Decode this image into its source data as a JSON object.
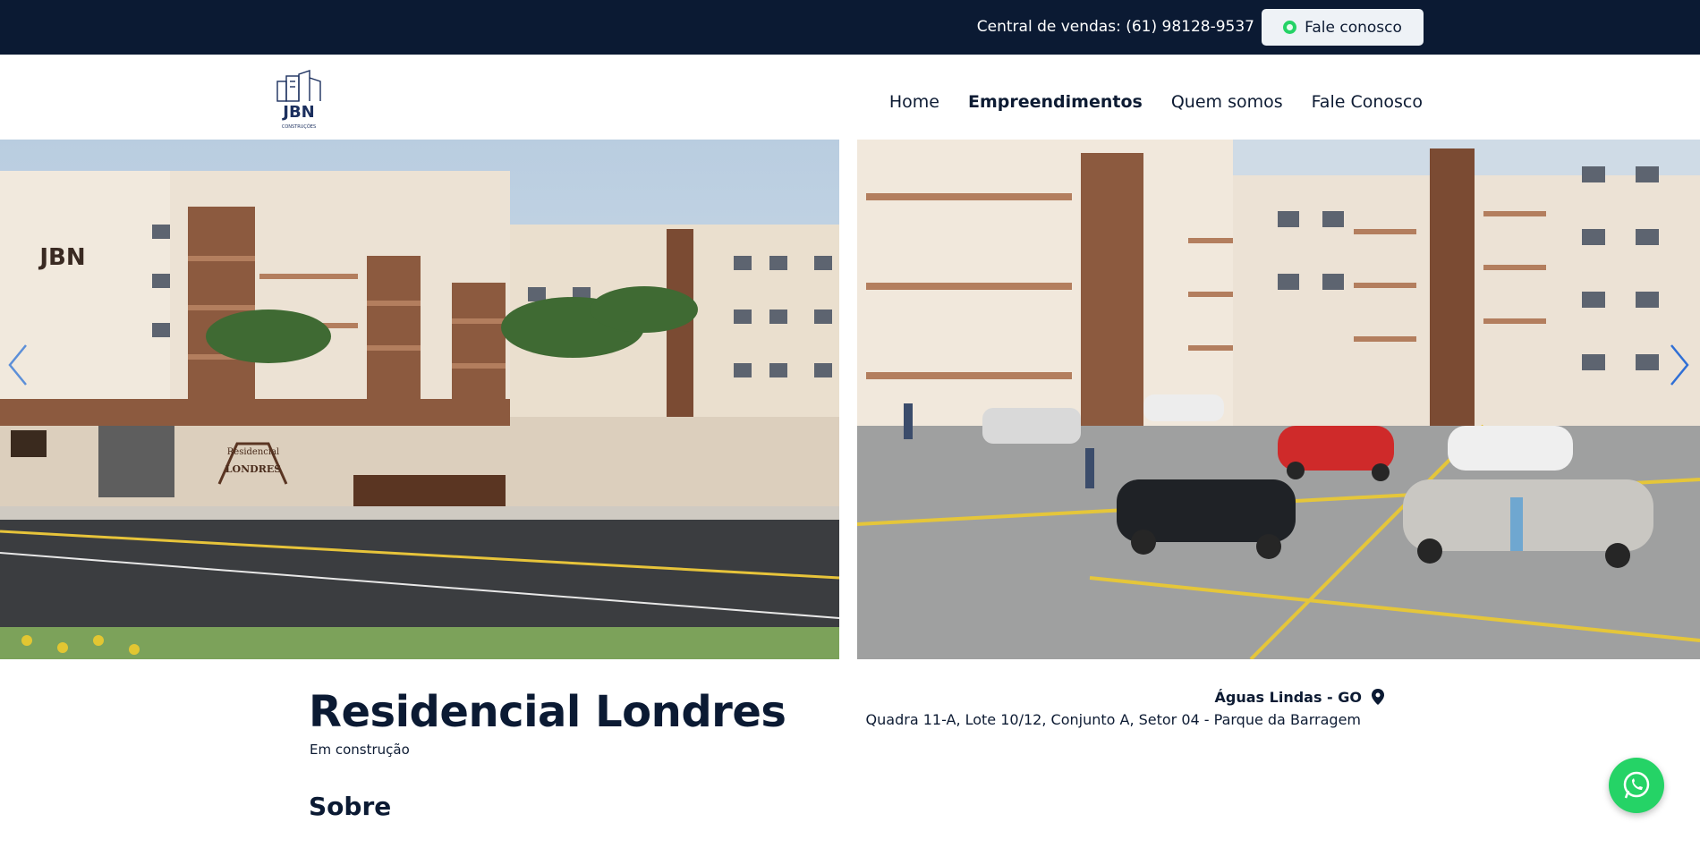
{
  "topbar": {
    "sales_text": "Central de vendas: (61) 98128-9537",
    "cta_label": "Fale conosco"
  },
  "header": {
    "logo_text": "JBN",
    "logo_subtext": "CONSTRUÇÕES",
    "nav": [
      {
        "label": "Home"
      },
      {
        "label": "Empreendimentos"
      },
      {
        "label": "Quem somos"
      },
      {
        "label": "Fale Conosco"
      }
    ]
  },
  "gallery": {
    "slide_1_sign": "Residencial\nLONDRES"
  },
  "property": {
    "title": "Residencial Londres",
    "status": "Em construção",
    "city": "Águas Lindas - GO",
    "address": "Quadra 11-A, Lote 10/12, Conjunto A, Setor 04 - Parque da Barragem"
  },
  "section": {
    "about_heading": "Sobre"
  },
  "colors": {
    "navy": "#0b1a33",
    "whatsapp": "#25d366",
    "arrow": "#3b82f6"
  }
}
